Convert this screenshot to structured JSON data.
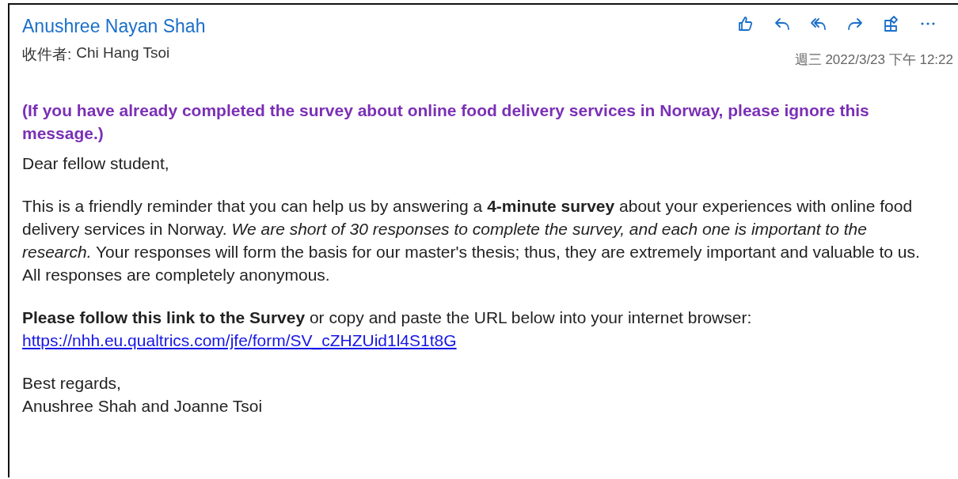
{
  "message": {
    "sender": "Anushree Nayan Shah",
    "recipient_label": "收件者:",
    "recipient": "Chi Hang Tsoi",
    "date": "週三 2022/3/23 下午 12:22",
    "actions": [
      {
        "kind": "like"
      },
      {
        "kind": "reply"
      },
      {
        "kind": "reply-all"
      },
      {
        "kind": "forward"
      },
      {
        "kind": "apps"
      },
      {
        "kind": "more"
      }
    ],
    "body": [
      {
        "kind": "notice",
        "text": "(If you have already completed the survey about online food delivery services in Norway, please ignore this message.)"
      },
      {
        "kind": "paragraph",
        "text": "Dear fellow student,"
      },
      {
        "kind": "paragraph",
        "text": "This is a friendly reminder that you can help us by answering a **4-minute survey** about your experiences with online food delivery services in Norway. *We are short of 30 responses to complete the survey, and each one is important to the research.* Your responses will form the basis for our master's thesis; thus, they are extremely important and valuable to us. All responses are completely anonymous."
      },
      {
        "kind": "link-paragraph",
        "text": "**Please follow this link to the Survey** or copy and paste the URL below into your internet browser:",
        "link": "https://nhh.eu.qualtrics.com/jfe/form/SV_cZHZUid1l4S1t8G"
      },
      {
        "kind": "lines",
        "lines": [
          "Best regards,",
          "Anushree Shah and Joanne Tsoi"
        ]
      }
    ]
  }
}
